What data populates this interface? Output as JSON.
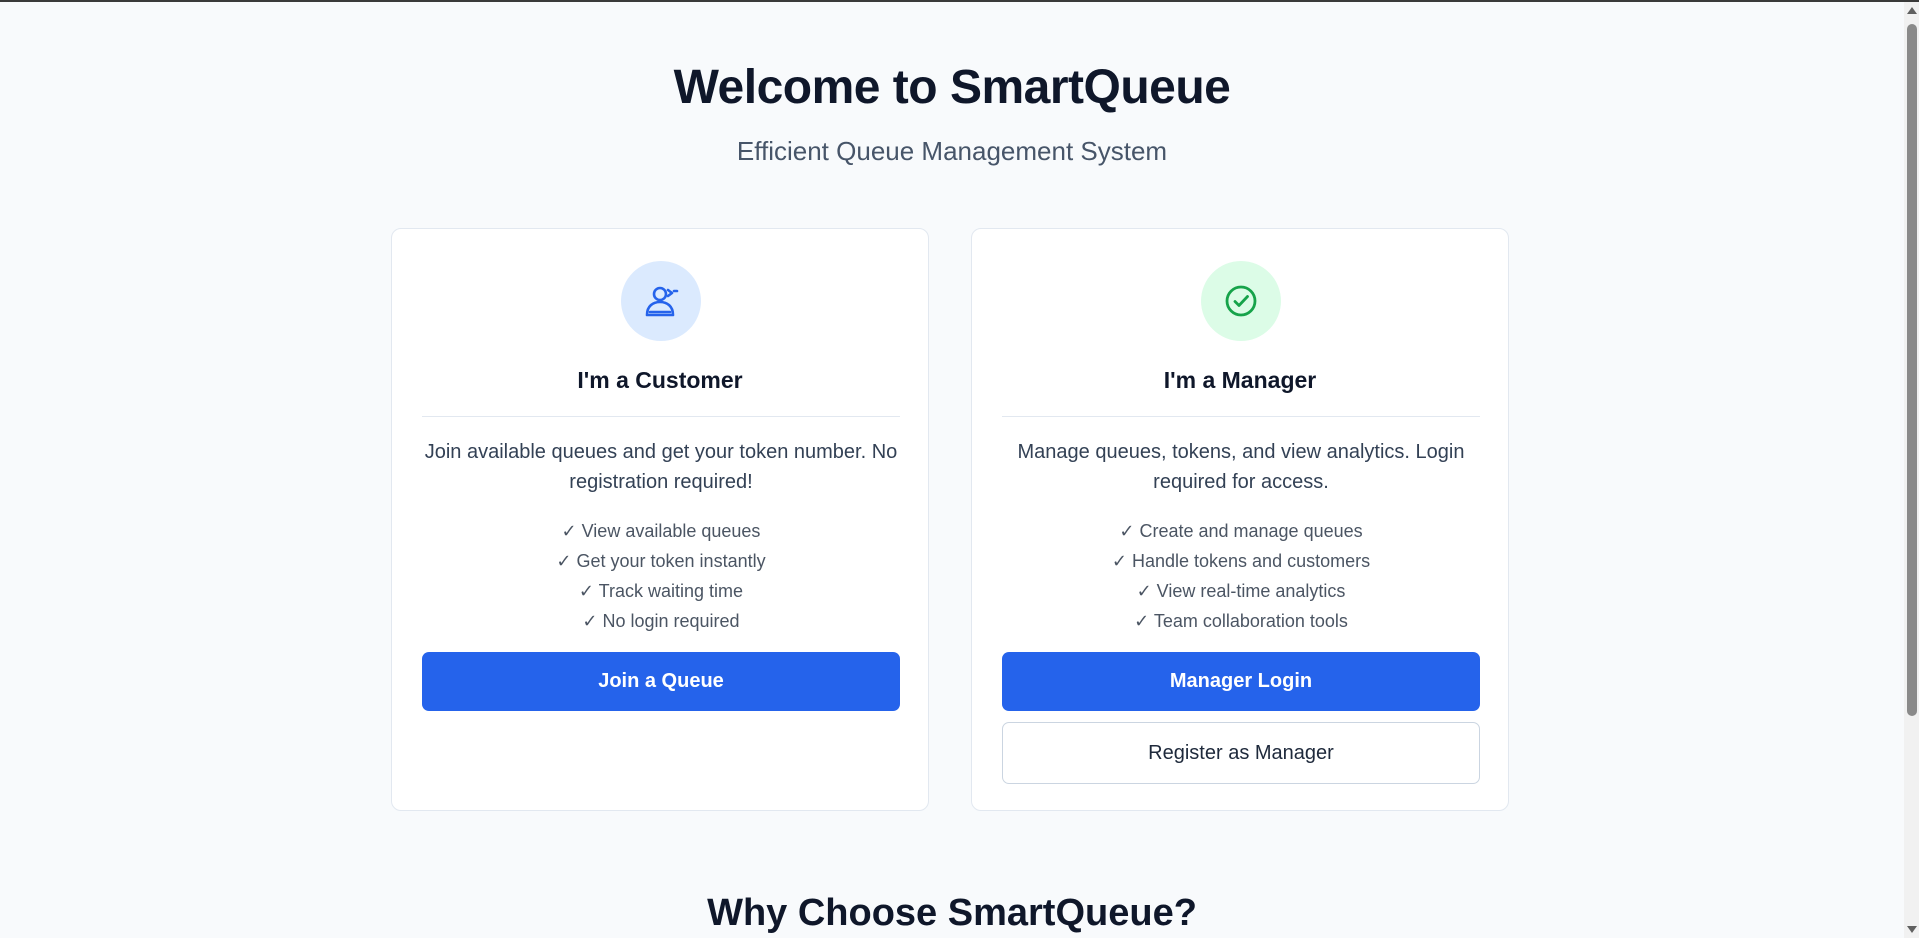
{
  "hero": {
    "title": "Welcome to SmartQueue",
    "subtitle": "Efficient Queue Management System"
  },
  "customer_card": {
    "icon": "user-icon",
    "title": "I'm a Customer",
    "description": "Join available queues and get your token number. No registration required!",
    "features": [
      "✓ View available queues",
      "✓ Get your token instantly",
      "✓ Track waiting time",
      "✓ No login required"
    ],
    "primary_button": "Join a Queue"
  },
  "manager_card": {
    "icon": "check-circle-icon",
    "title": "I'm a Manager",
    "description": "Manage queues, tokens, and view analytics. Login required for access.",
    "features": [
      "✓ Create and manage queues",
      "✓ Handle tokens and customers",
      "✓ View real-time analytics",
      "✓ Team collaboration tools"
    ],
    "primary_button": "Manager Login",
    "secondary_button": "Register as Manager"
  },
  "why_section": {
    "title": "Why Choose SmartQueue?"
  },
  "colors": {
    "primary": "#2563eb",
    "customer_icon_bg": "#dbeafe",
    "customer_icon": "#2563eb",
    "manager_icon_bg": "#dcfce7",
    "manager_icon": "#16a34a",
    "page_bg": "#f8fafc"
  }
}
